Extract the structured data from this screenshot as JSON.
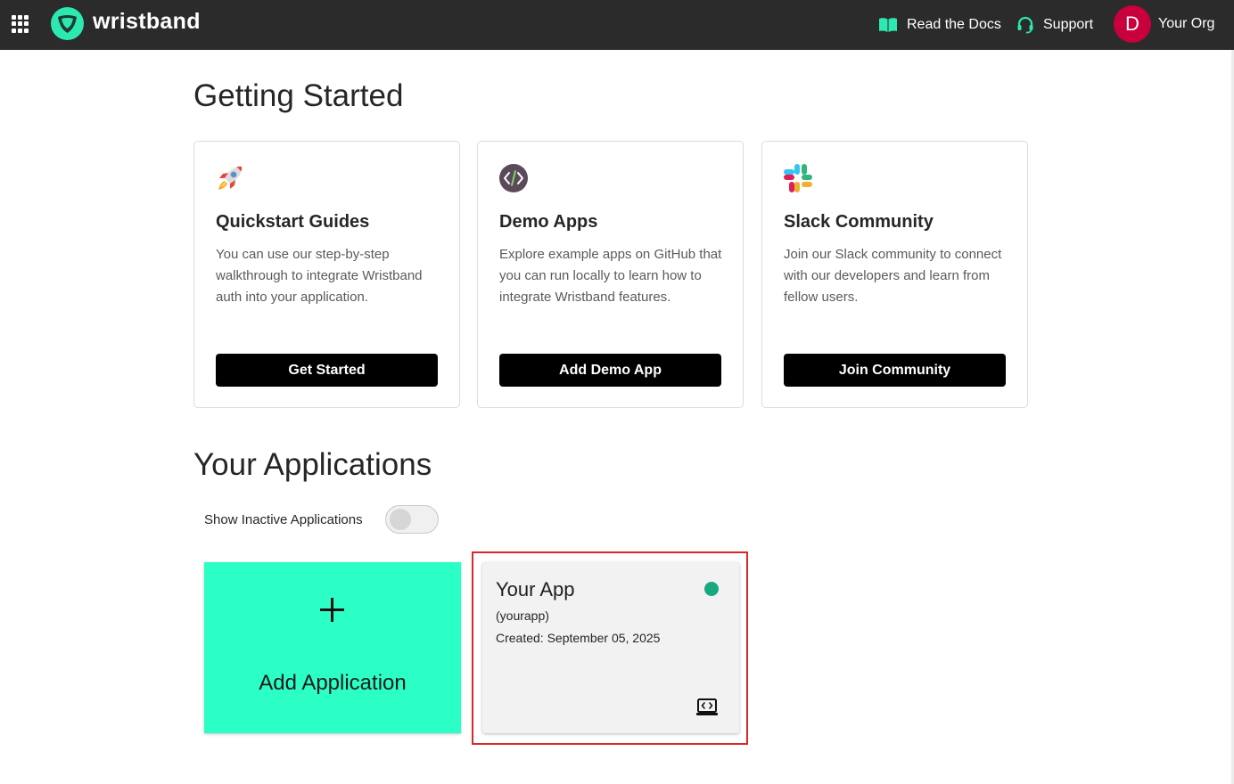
{
  "header": {
    "brand": "wristband",
    "docs_label": "Read the Docs",
    "support_label": "Support",
    "org_initial": "D",
    "org_name": "Your Org",
    "icons": [
      "apps-grid-icon",
      "wristband-logo-icon",
      "book-icon",
      "headset-icon"
    ]
  },
  "getting_started": {
    "title": "Getting Started",
    "cards": [
      {
        "icon": "rocket-icon",
        "title": "Quickstart Guides",
        "description": "You can use our step-by-step walkthrough to integrate Wristband auth into your application.",
        "button": "Get Started"
      },
      {
        "icon": "code-icon",
        "title": "Demo Apps",
        "description": "Explore example apps on GitHub that you can run locally to learn how to integrate Wristband features.",
        "button": "Add Demo App"
      },
      {
        "icon": "slack-icon",
        "title": "Slack Community",
        "description": "Join our Slack community to connect with our developers and learn from fellow users.",
        "button": "Join Community"
      }
    ]
  },
  "applications": {
    "title": "Your Applications",
    "toggle_label": "Show Inactive Applications",
    "toggle_on": false,
    "add_label": "Add Application",
    "items": [
      {
        "name": "Your App",
        "slug": "(yourapp)",
        "created": "Created: September 05, 2025",
        "status": "active"
      }
    ]
  },
  "colors": {
    "topbar": "#2b2b2b",
    "accent": "#2bffc6",
    "brand_green": "#2de8b0",
    "avatar": "#c8003c",
    "status_active": "#1aa881",
    "highlight": "#d92828"
  }
}
